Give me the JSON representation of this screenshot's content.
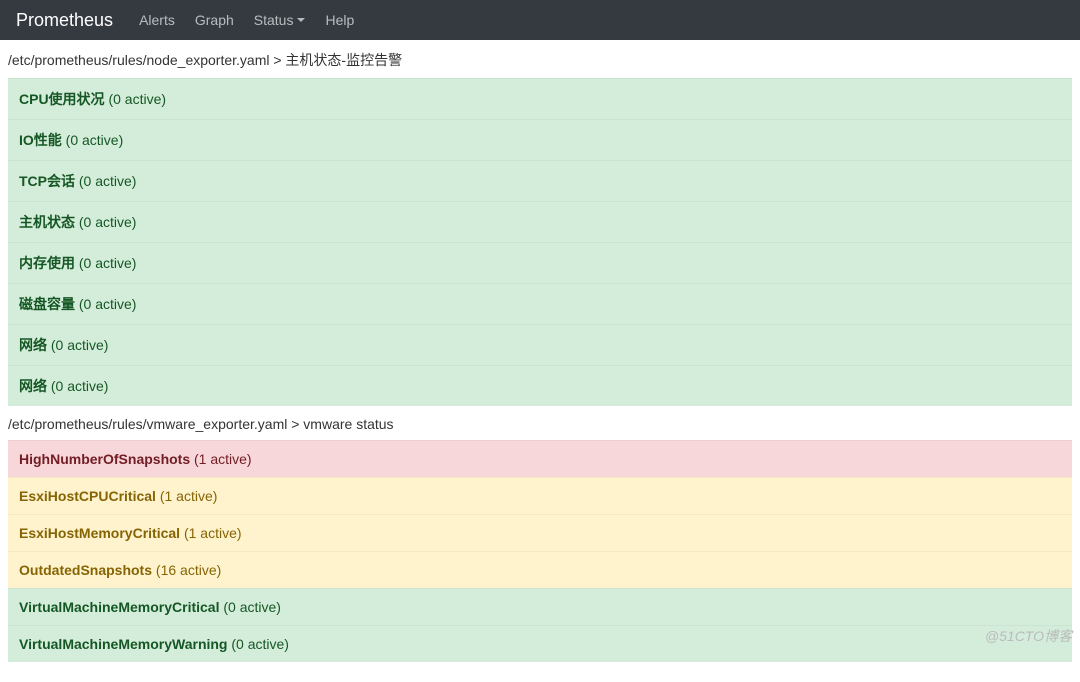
{
  "brand": "Prometheus",
  "nav": {
    "alerts": "Alerts",
    "graph": "Graph",
    "status": "Status",
    "help": "Help"
  },
  "groups": [
    {
      "header": "/etc/prometheus/rules/node_exporter.yaml > 主机状态-监控告警",
      "rules": [
        {
          "name": "CPU使用状况",
          "count": "(0 active)",
          "state": "ok"
        },
        {
          "name": "IO性能",
          "count": "(0 active)",
          "state": "ok"
        },
        {
          "name": "TCP会话",
          "count": "(0 active)",
          "state": "ok"
        },
        {
          "name": "主机状态",
          "count": "(0 active)",
          "state": "ok"
        },
        {
          "name": "内存使用",
          "count": "(0 active)",
          "state": "ok"
        },
        {
          "name": "磁盘容量",
          "count": "(0 active)",
          "state": "ok"
        },
        {
          "name": "网络",
          "count": "(0 active)",
          "state": "ok"
        },
        {
          "name": "网络",
          "count": "(0 active)",
          "state": "ok"
        }
      ]
    },
    {
      "header": "/etc/prometheus/rules/vmware_exporter.yaml > vmware status",
      "rules": [
        {
          "name": "HighNumberOfSnapshots",
          "count": "(1 active)",
          "state": "firing"
        },
        {
          "name": "EsxiHostCPUCritical",
          "count": "(1 active)",
          "state": "pending"
        },
        {
          "name": "EsxiHostMemoryCritical",
          "count": "(1 active)",
          "state": "pending"
        },
        {
          "name": "OutdatedSnapshots",
          "count": "(16 active)",
          "state": "pending"
        },
        {
          "name": "VirtualMachineMemoryCritical",
          "count": "(0 active)",
          "state": "ok"
        },
        {
          "name": "VirtualMachineMemoryWarning",
          "count": "(0 active)",
          "state": "ok"
        }
      ]
    }
  ],
  "watermark": "@51CTO博客"
}
